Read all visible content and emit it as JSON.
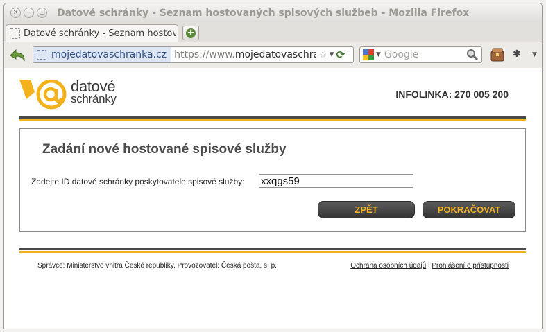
{
  "window": {
    "title": "Datové schránky - Seznam hostovaných spisových službeb - Mozilla Firefox",
    "controls": {
      "close": "×",
      "minimize": "–",
      "maximize": "□"
    }
  },
  "tabs": [
    {
      "label": "Datové schránky - Seznam hostovaných spisových službeb"
    }
  ],
  "new_tab_symbol": "+",
  "navbar": {
    "site_identity": "mojedatovaschranka.cz",
    "url_prefix": "https://www.",
    "url_host": "mojedatovaschranka.cz/",
    "search_placeholder": "Google"
  },
  "header": {
    "logo_line1": "datové",
    "logo_line2": "schránky",
    "infolinka": "INFOLINKA: 270 005 200"
  },
  "form": {
    "title": "Zadání nové hostované spisové služby",
    "id_label": "Zadejte ID datové schránky poskytovatele spisové služby:",
    "id_value": "xxqgs59",
    "back_button": "ZPĚT",
    "continue_button": "POKRAČOVAT"
  },
  "footer": {
    "left": "Správce: Ministerstvo vnitra České republiky, Provozovatel: Česká pošta, s. p.",
    "privacy_link": "Ochrana osobních údajů",
    "separator": "|",
    "accessibility_link": "Prohlášení o přístupnosti"
  },
  "colors": {
    "brand_yellow": "#f3b21b",
    "brand_dark": "#4a4a4a",
    "button_text": "#f5b325"
  },
  "icons": [
    "back-arrow-icon",
    "bookmark-star-icon",
    "reload-icon",
    "google-icon",
    "search-magnifier-icon",
    "extension-icon"
  ]
}
